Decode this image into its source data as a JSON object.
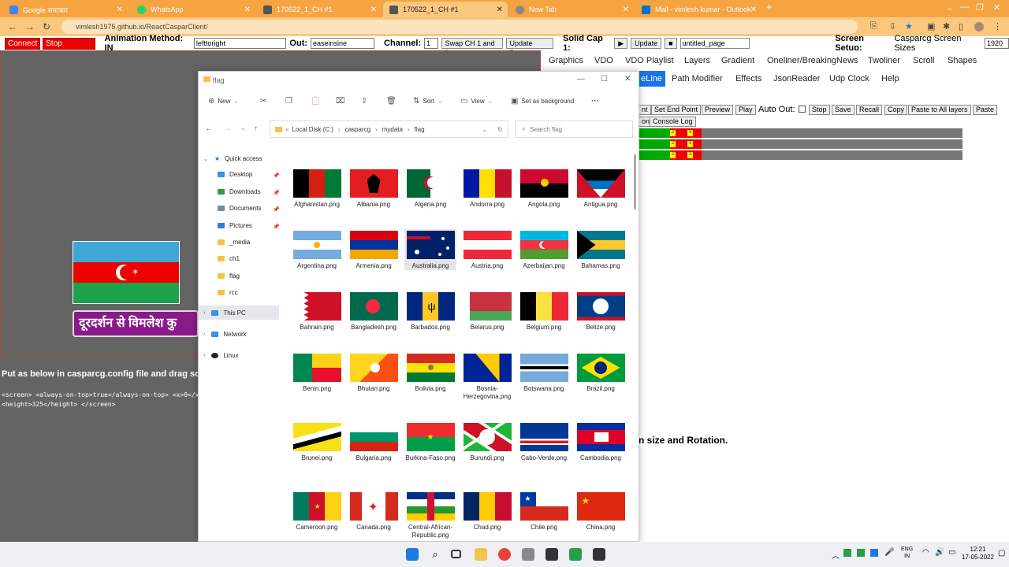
{
  "browser": {
    "tabs": [
      {
        "title": "Google समाचार",
        "color": "#4285f4"
      },
      {
        "title": "WhatsApp",
        "color": "#25d366"
      },
      {
        "title": "170522_1_CH #1",
        "color": "#555"
      },
      {
        "title": "170522_1_CH #1",
        "color": "#555",
        "active": true
      },
      {
        "title": "New Tab",
        "color": "#888"
      },
      {
        "title": "Mail - vimlesh kumar - Outlook",
        "color": "#0072c6"
      }
    ],
    "url": "vimlesh1975.github.io/ReactCasparClient/"
  },
  "toolbar": {
    "connect": "Connect",
    "stop_channel": "Stop Channel",
    "animation_label": "Animation Method: IN",
    "in_value": "lefttoright",
    "out_label": "Out:",
    "out_value": "easeinsine",
    "channel_label": "Channel:",
    "channel_value": "1",
    "swap": "Swap CH 1 and 2",
    "update_page": "Update Page",
    "solid_cap": "Solid Cap 1:",
    "update": "Update",
    "page_name": "untitled_page",
    "screen_setup": "Screen Setup:",
    "screen_sizes": "Casparcg Screen Sizes",
    "screen_value": "1920"
  },
  "menu_tabs_row1": [
    "Graphics",
    "VDO",
    "VDO Playlist",
    "Layers",
    "Gradient",
    "Oneliner/BreakingNews",
    "Twoliner",
    "Scroll",
    "Shapes"
  ],
  "menu_tabs_row2": [
    "eLine",
    "Path Modifier",
    "Effects",
    "JsonReader",
    "Udp Clock",
    "Help"
  ],
  "right_buttons": [
    "nt",
    "Set End Point",
    "Preview",
    "Play",
    "Stop",
    "Save",
    "Recall",
    "Copy",
    "Paste to All layers",
    "Paste"
  ],
  "auto_out": "Auto Out:",
  "console": [
    "on",
    "Console Log"
  ],
  "right_text": "n size and Rotation.",
  "left": {
    "ticker_text": "दूरदर्शन से विमलेश कु",
    "note": "Put as below in casparcg.config file and drag scre",
    "code1": "<screen> <always-on-top>true</always-on-top> <x>0</x",
    "code2": "<height>325</height> </screen>"
  },
  "explorer": {
    "title": "flag",
    "cmd": [
      "New",
      "Sort",
      "View",
      "Set as background"
    ],
    "path": [
      "Local Disk (C:)",
      "casparcg",
      "mydata",
      "flag"
    ],
    "search_placeholder": "Search flag",
    "tree": [
      "Quick access",
      "Desktop",
      "Downloads",
      "Documents",
      "Pictures",
      "_media",
      "ch1",
      "flag",
      "rcc",
      "This PC",
      "Network",
      "Linux"
    ],
    "files": [
      "Afghanistan.png",
      "Albania.png",
      "Algeria.png",
      "Andorra.png",
      "Angola.png",
      "Antigua.png",
      "Argentina.png",
      "Armenia.png",
      "Australia.png",
      "Austria.png",
      "Azerbaijan.png",
      "Bahamas.png",
      "Bahrain.png",
      "Bangladesh.png",
      "Barbados.png",
      "Belarus.png",
      "Belgium.png",
      "Belize.png",
      "Benin.png",
      "Bhutan.png",
      "Bolivia.png",
      "Bosnia-Herzegovina.png",
      "Botswana.png",
      "Brazil.png",
      "Brunei.png",
      "Bulgaria.png",
      "Burkina-Faso.png",
      "Burundi.png",
      "Cabo-Verde.png",
      "Cambodia.png",
      "Cameroon.png",
      "Canada.png",
      "Central-African-Republic.png",
      "Chad.png",
      "Chile.png",
      "China.png"
    ]
  },
  "taskbar": {
    "lang1": "ENG",
    "lang2": "IN",
    "time": "12:21",
    "date": "17-05-2022"
  }
}
